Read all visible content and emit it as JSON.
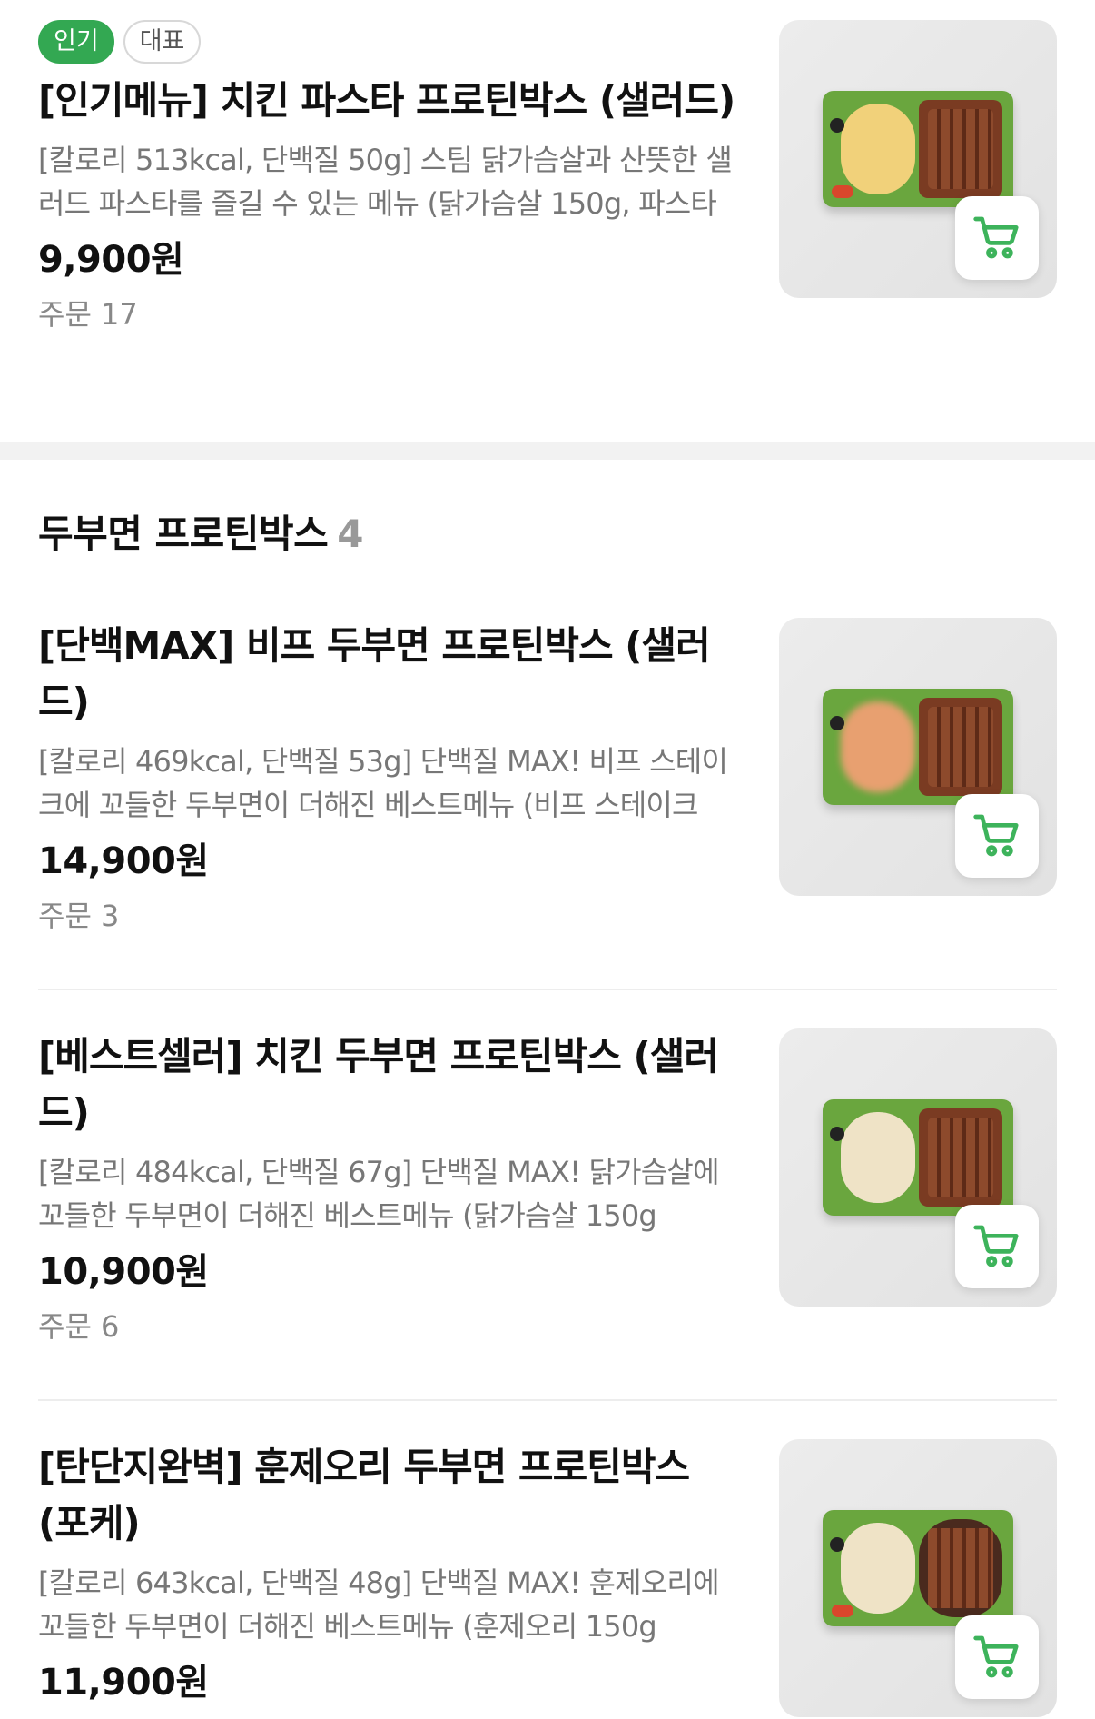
{
  "top_item": {
    "badges": [
      "인기",
      "대표"
    ],
    "title": "[인기메뉴] 치킨 파스타 프로틴박스 (샐러드)",
    "description": "[칼로리 513kcal, 단백질 50g] 스팀 닭가슴살과 산뜻한 샐러드 파스타를 즐길 수 있는 메뉴 (닭가슴살 150g, 파스타",
    "price": "9,900원",
    "orders": "주문 17"
  },
  "section": {
    "title": "두부면 프로틴박스",
    "count": "4"
  },
  "items": [
    {
      "title": "[단백MAX] 비프 두부면 프로틴박스 (샐러드)",
      "description": "[칼로리 469kcal, 단백질 53g] 단백질 MAX! 비프 스테이크에 꼬들한 두부면이 더해진 베스트메뉴 (비프 스테이크",
      "price": "14,900원",
      "orders": "주문 3"
    },
    {
      "title": "[베스트셀러] 치킨 두부면 프로틴박스 (샐러드)",
      "description": "[칼로리 484kcal, 단백질 67g] 단백질 MAX! 닭가슴살에 꼬들한 두부면이 더해진 베스트메뉴 (닭가슴살 150g",
      "price": "10,900원",
      "orders": "주문 6"
    },
    {
      "title": "[탄단지완벽] 훈제오리 두부면 프로틴박스 (포케)",
      "description": "[칼로리 643kcal, 단백질 48g] 단백질 MAX! 훈제오리에 꼬들한 두부면이 더해진 베스트메뉴 (훈제오리 150g",
      "price": "11,900원",
      "orders": ""
    }
  ],
  "colors": {
    "accent": "#33a852",
    "cart_icon": "#3db35b",
    "muted_text": "#777777",
    "divider": "#f2f2f2"
  },
  "icons": {
    "cart": "shopping-cart-icon"
  }
}
